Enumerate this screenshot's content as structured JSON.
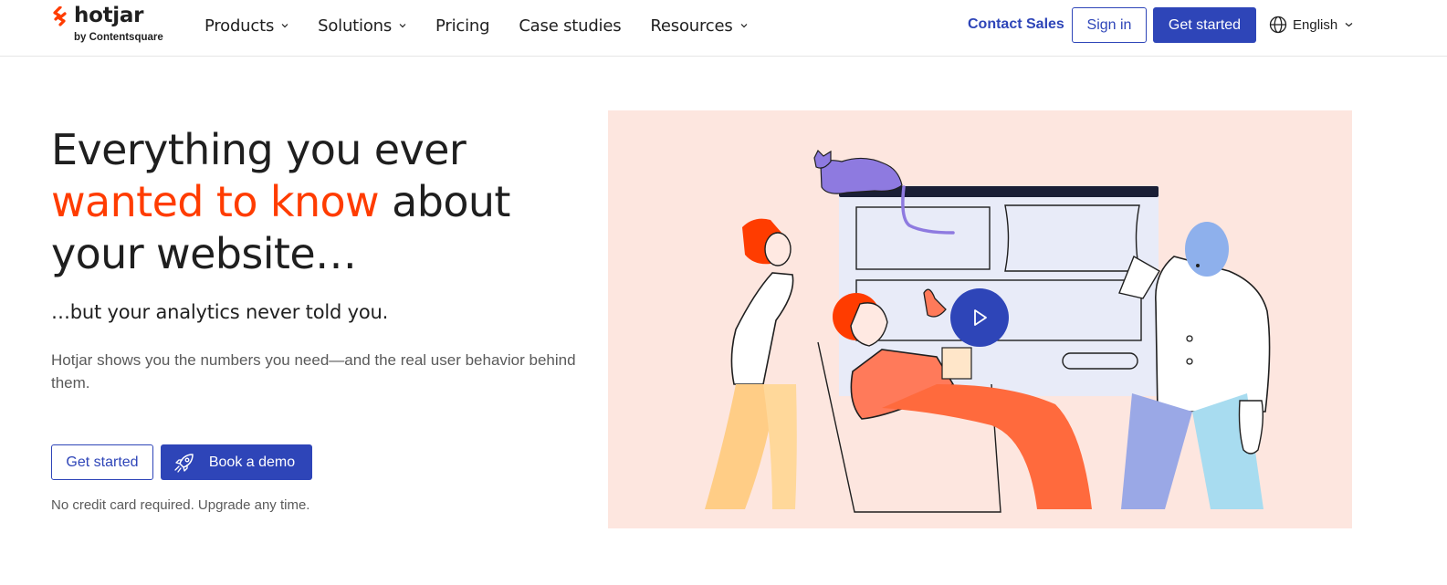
{
  "brand": {
    "name": "hotjar",
    "tagline": "by Contentsquare",
    "accent": "#ff3c00",
    "primary": "#2e45b8"
  },
  "nav": {
    "items": [
      {
        "label": "Products",
        "dropdown": true
      },
      {
        "label": "Solutions",
        "dropdown": true
      },
      {
        "label": "Pricing",
        "dropdown": false
      },
      {
        "label": "Case studies",
        "dropdown": false
      },
      {
        "label": "Resources",
        "dropdown": true
      }
    ],
    "contact_sales": "Contact Sales",
    "sign_in": "Sign in",
    "get_started": "Get started",
    "language": "English"
  },
  "hero": {
    "title_part1": "Everything you ever",
    "title_highlight": "wanted to know",
    "title_part2": "about your website…",
    "subtitle": "…but your analytics never told you.",
    "description": "Hotjar shows you the numbers you need—and the real user behavior behind them.",
    "cta_primary": "Get started",
    "cta_secondary": "Book a demo",
    "note": "No credit card required. Upgrade any time.",
    "illustration_bg": "#fde6df"
  },
  "icons": {
    "logo": "hotjar-logo-icon",
    "caret": "chevron-down-icon",
    "globe": "globe-icon",
    "rocket": "rocket-icon",
    "play": "play-icon"
  }
}
